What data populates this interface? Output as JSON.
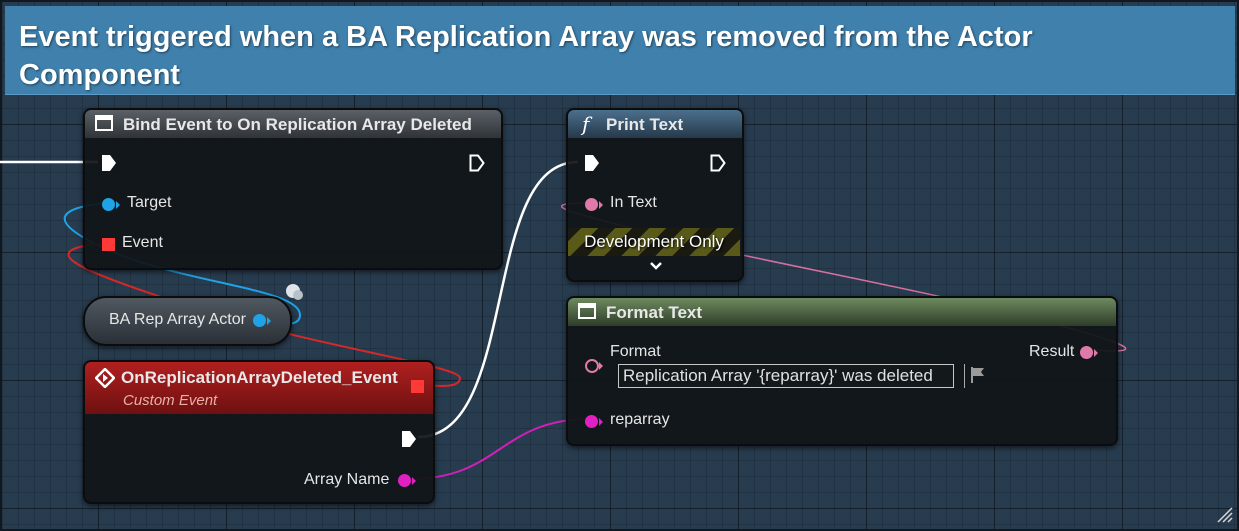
{
  "comment": {
    "title": "Event triggered when a BA Replication Array was removed from the Actor Component"
  },
  "bind_event_node": {
    "title": "Bind Event to On Replication Array Deleted",
    "pin_target": "Target",
    "pin_event": "Event"
  },
  "getter_node": {
    "label": "BA Rep Array Actor"
  },
  "custom_event_node": {
    "title": "OnReplicationArrayDeleted_Event",
    "subtitle": "Custom Event",
    "pin_array_name": "Array Name"
  },
  "print_text_node": {
    "title": "Print Text",
    "icon_glyph": "f",
    "pin_in_text": "In Text",
    "dev_only_label": "Development Only",
    "expand_glyph": "⌄"
  },
  "format_text_node": {
    "title": "Format Text",
    "pin_format": "Format",
    "format_value": "Replication Array '{reparray}' was deleted",
    "pin_result": "Result",
    "pin_reparray": "reparray"
  },
  "colors": {
    "exec_wire": "#ffffff",
    "object_pin": "#1fa3e6",
    "delegate_pin": "#ff3838",
    "text_pin": "#e07aa8",
    "name_pin": "#e020c0",
    "comment_header": "#3f80ad",
    "graph_background": "#283c4f"
  },
  "icons": [
    "function-icon",
    "node-icon",
    "event-diamond-icon",
    "flag-icon",
    "expand-chevron-icon",
    "resize-grip-icon"
  ]
}
